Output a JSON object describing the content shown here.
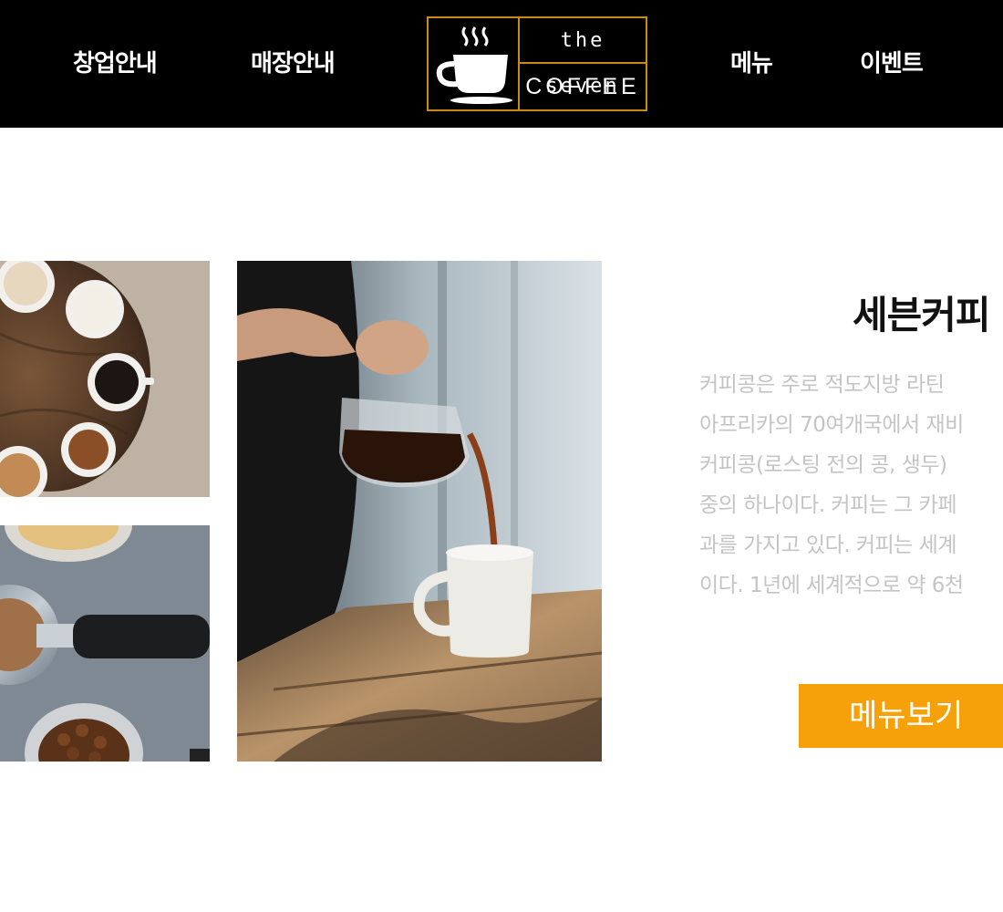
{
  "nav": {
    "items": [
      {
        "label": "창업안내"
      },
      {
        "label": "매장안내"
      },
      {
        "label": "메뉴"
      },
      {
        "label": "이벤트"
      }
    ]
  },
  "logo": {
    "line1": "the seven",
    "line2": "COFFEE",
    "icon": "coffee-cup-icon"
  },
  "photos": [
    {
      "name": "latte-cups-photo"
    },
    {
      "name": "espresso-portafilter-photo"
    },
    {
      "name": "pour-over-coffee-photo"
    }
  ],
  "about": {
    "title": "세븐커피",
    "lines": [
      "커피콩은 주로 적도지방 라틴",
      "아프리카의 70여개국에서 재비",
      "커피콩(로스팅 전의 콩, 생두)",
      "중의 하나이다.  커피는 그 카페",
      "과를 가지고 있다. 커피는 세계",
      "이다. 1년에 세계적으로 약 6천"
    ]
  },
  "cta": {
    "label": "메뉴보기"
  },
  "colors": {
    "header_bg": "#000000",
    "logo_border": "#c98a1a",
    "button_bg": "#f6a10a",
    "description_text": "#c4c4c4"
  }
}
